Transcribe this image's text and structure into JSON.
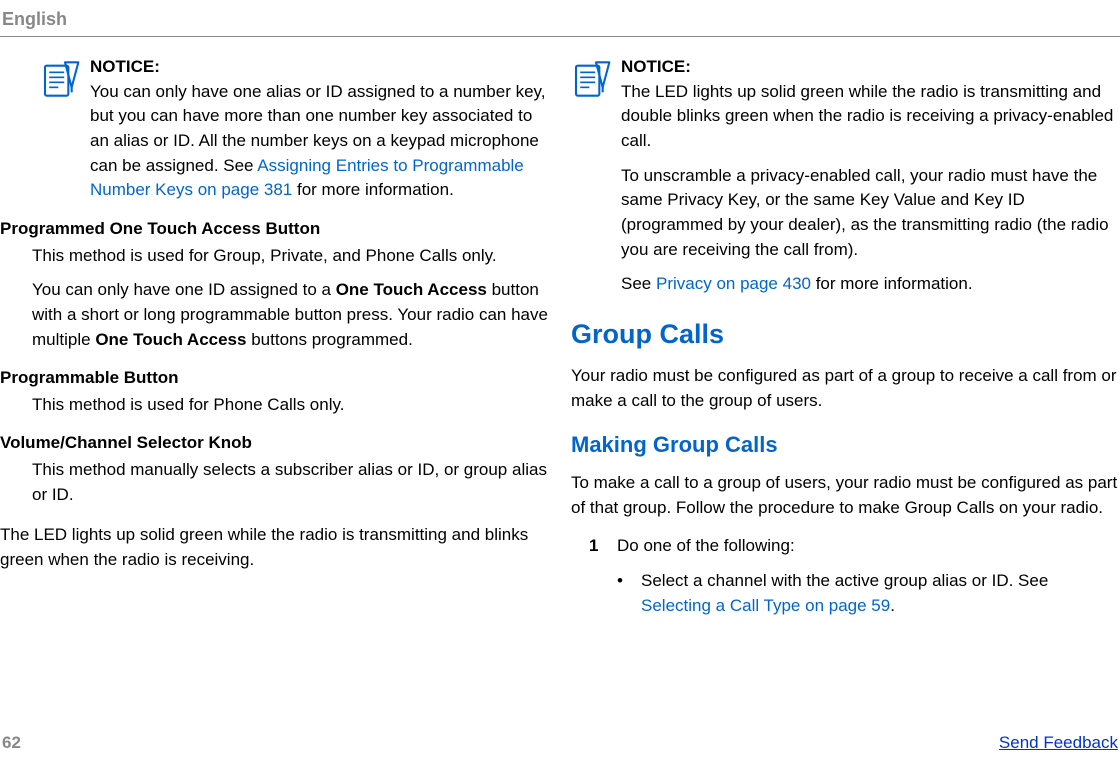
{
  "header": {
    "language": "English"
  },
  "left": {
    "notice": {
      "title": "NOTICE:",
      "text_part1": "You can only have one alias or ID assigned to a number key, but you can have more than one number key associated to an alias or ID. All the number keys on a keypad microphone can be assigned. See ",
      "link": "Assigning Entries to Programmable Number Keys on page 381",
      "text_part2": " for more information."
    },
    "sec1_heading": "Programmed One Touch Access Button",
    "sec1_p1": "This method is used for Group, Private, and Phone Calls only.",
    "sec1_p2a": "You can only have one ID assigned to a ",
    "sec1_p2b": "One Touch Access",
    "sec1_p2c": " button with a short or long programmable button press. Your radio can have multiple ",
    "sec1_p2d": "One Touch Access",
    "sec1_p2e": " buttons programmed.",
    "sec2_heading": "Programmable Button",
    "sec2_p1": "This method is used for Phone Calls only.",
    "sec3_heading": "Volume/Channel Selector Knob",
    "sec3_p1": "This method manually selects a subscriber alias or ID, or group alias or ID.",
    "led_p": "The LED lights up solid green while the radio is transmitting and blinks green when the radio is receiving."
  },
  "right": {
    "notice": {
      "title": "NOTICE:",
      "p1": "The LED lights up solid green while the radio is transmitting and double blinks green when the radio is receiving a privacy-enabled call.",
      "p2": "To unscramble a privacy-enabled call, your radio must have the same Privacy Key, or the same Key Value and Key ID (programmed by your dealer), as the transmitting radio (the radio you are receiving the call from).",
      "p3a": "See ",
      "p3_link": "Privacy on page 430",
      "p3b": " for more information."
    },
    "h2": "Group Calls",
    "h2_p": "Your radio must be configured as part of a group to receive a call from or make a call to the group of users.",
    "h3": "Making Group Calls",
    "h3_p": "To make a call to a group of users, your radio must be configured as part of that group. Follow the procedure to make Group Calls on your radio.",
    "step1_num": "1",
    "step1_text": "Do one of the following:",
    "bullet1a": "Select a channel with the active group alias or ID. See ",
    "bullet1_link": "Selecting a Call Type on page 59",
    "bullet1b": "."
  },
  "footer": {
    "page": "62",
    "feedback": "Send Feedback"
  }
}
